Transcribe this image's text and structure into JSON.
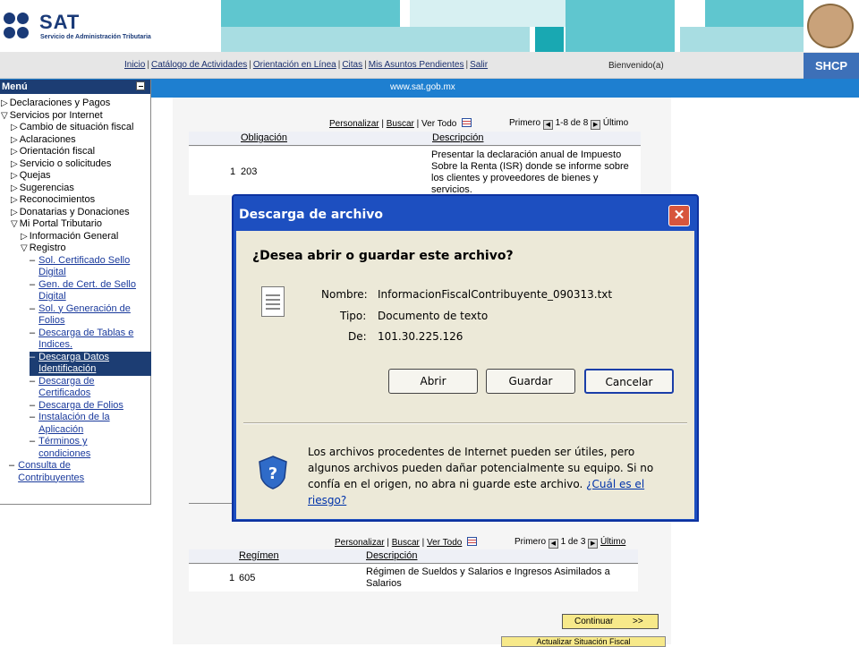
{
  "header": {
    "logo_text": "SAT",
    "logo_sub": "Servicio de Administración Tributaria",
    "shcp": "SHCP",
    "url": "www.sat.gob.mx"
  },
  "nav": {
    "links": [
      "Inicio",
      "Catálogo de Actividades",
      "Orientación en Línea",
      "Citas",
      "Mis Asuntos Pendientes",
      "Salir"
    ],
    "welcome": "Bienvenido(a)"
  },
  "menu": {
    "title": "Menú",
    "items": [
      {
        "label": "Declaraciones y Pagos",
        "marker": "▷",
        "indent": 0,
        "link": false
      },
      {
        "label": "Servicios por Internet",
        "marker": "▽",
        "indent": 0,
        "link": false
      },
      {
        "label": "Cambio de situación fiscal",
        "marker": "▷",
        "indent": 1,
        "link": false
      },
      {
        "label": "Aclaraciones",
        "marker": "▷",
        "indent": 1,
        "link": false
      },
      {
        "label": "Orientación fiscal",
        "marker": "▷",
        "indent": 1,
        "link": false
      },
      {
        "label": "Servicio o solicitudes",
        "marker": "▷",
        "indent": 1,
        "link": false
      },
      {
        "label": "Quejas",
        "marker": "▷",
        "indent": 1,
        "link": false
      },
      {
        "label": "Sugerencias",
        "marker": "▷",
        "indent": 1,
        "link": false
      },
      {
        "label": "Reconocimientos",
        "marker": "▷",
        "indent": 1,
        "link": false
      },
      {
        "label": "Donatarias y Donaciones",
        "marker": "▷",
        "indent": 1,
        "link": false
      },
      {
        "label": "Mi Portal Tributario",
        "marker": "▽",
        "indent": 1,
        "link": false
      },
      {
        "label": "Información General",
        "marker": "▷",
        "indent": 2,
        "link": false
      },
      {
        "label": "Registro",
        "marker": "▽",
        "indent": 2,
        "link": false
      }
    ],
    "sublinks": [
      [
        "Sol. Certificado Sello",
        "Digital"
      ],
      [
        "Gen. de Cert. de Sello",
        "Digital"
      ],
      [
        "Sol. y Generación de",
        "Folios"
      ],
      [
        "Descarga de Tablas e",
        "Indices."
      ],
      [
        "Descarga Datos",
        "Identificación"
      ],
      [
        "Descarga de",
        "Certificados"
      ],
      [
        "Descarga de Folios"
      ],
      [
        "Instalación de la",
        "Aplicación"
      ],
      [
        "Términos y",
        "condiciones"
      ]
    ],
    "consulta": [
      "Consulta de",
      "Contribuyentes"
    ]
  },
  "table1": {
    "toolbar": {
      "personalizar": "Personalizar",
      "buscar": "Buscar",
      "ver_todo": "Ver Todo",
      "primero": "Primero",
      "range": "1-8 de 8",
      "ultimo": "Último"
    },
    "headers": [
      "Obligación",
      "Descripción"
    ],
    "row": {
      "num": "1",
      "code": "203",
      "desc": "Presentar la  declaración anual de Impuesto Sobre la Renta (ISR) donde se informe sobre los clientes y proveedores de bienes y servicios."
    }
  },
  "table2": {
    "toolbar": {
      "personalizar": "Personalizar",
      "buscar": "Buscar",
      "ver_todo": "Ver Todo",
      "primero": "Primero",
      "range": "1 de 3",
      "ultimo": "Último"
    },
    "headers": [
      "Regímen",
      "Descripción"
    ],
    "row": {
      "num": "1",
      "code": "605",
      "desc": "Régimen de Sueldos y Salarios e Ingresos Asimilados a Salarios"
    }
  },
  "buttons": {
    "continuar": "Continuar",
    "continuar_arrow": ">>",
    "actualizar": "Actualizar Situación Fiscal"
  },
  "dialog": {
    "title": "Descarga de archivo",
    "question": "¿Desea abrir o guardar este archivo?",
    "labels": {
      "nombre": "Nombre:",
      "tipo": "Tipo:",
      "de": "De:"
    },
    "values": {
      "nombre": "InformacionFiscalContribuyente_090313.txt",
      "tipo": "Documento de texto",
      "de": "101.30.225.126"
    },
    "buttons": {
      "abrir": "Abrir",
      "guardar": "Guardar",
      "cancelar": "Cancelar"
    },
    "warning": "Los archivos procedentes de Internet pueden ser útiles, pero algunos archivos pueden dañar potencialmente su equipo. Si no confía en el origen, no abra ni guarde este archivo.",
    "warning_link": "¿Cuál es el riesgo?"
  },
  "colors": {
    "nav_blue": "#1c3d73",
    "bar_blue": "#1e7fd0",
    "dialog_blue": "#1d4fc0",
    "button_yellow": "#f7e98a"
  }
}
